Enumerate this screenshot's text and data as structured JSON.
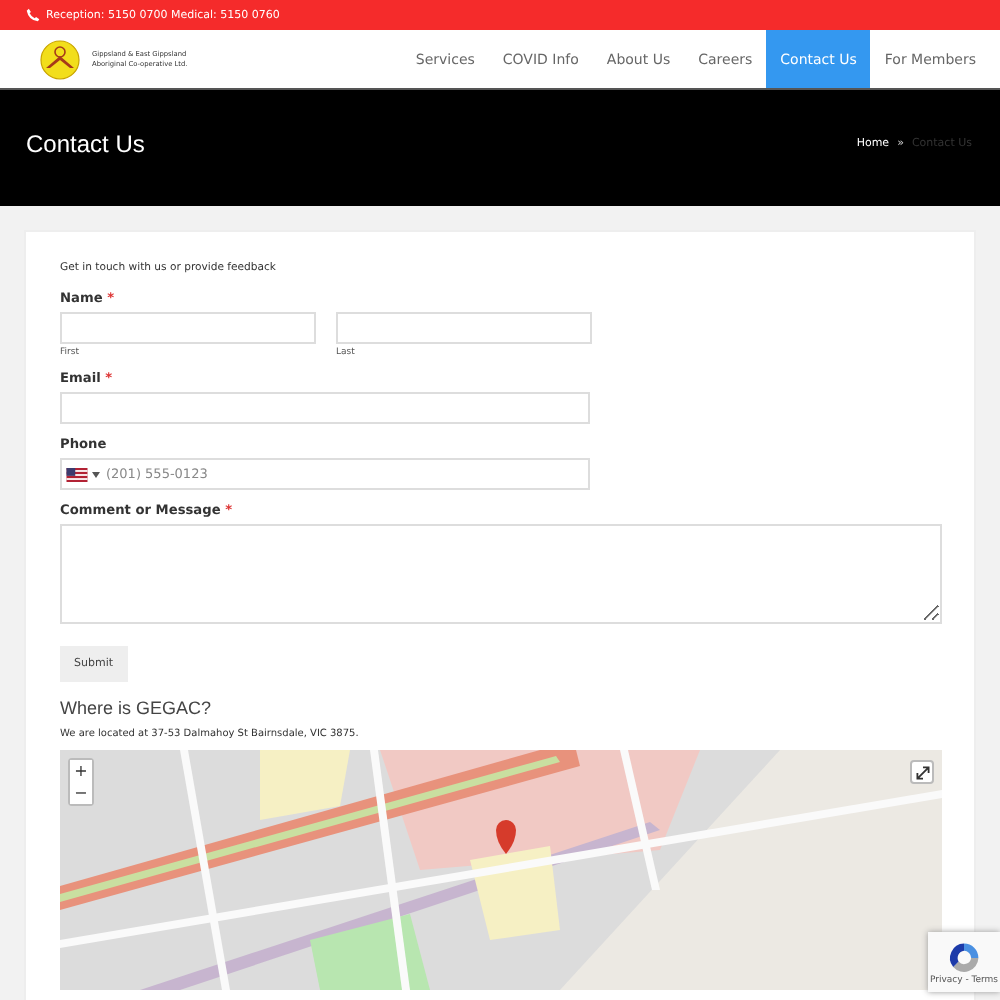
{
  "top_bar": {
    "phone_text": "Reception: 5150 0700 Medical: 5150 0760"
  },
  "header": {
    "logo_text": "Gippsland & East Gippsland Aboriginal Co-operative Ltd.",
    "nav": [
      {
        "label": "Services",
        "selected": false
      },
      {
        "label": "COVID Info",
        "selected": false
      },
      {
        "label": "About Us",
        "selected": false
      },
      {
        "label": "Careers",
        "selected": false
      },
      {
        "label": "Contact Us",
        "selected": true
      },
      {
        "label": "For Members",
        "selected": false
      }
    ]
  },
  "hero": {
    "title": "Contact Us",
    "breadcrumb": [
      {
        "label": "Home",
        "selected": false
      },
      {
        "label": "»",
        "kind": "separator"
      },
      {
        "label": "Contact Us",
        "selected": true
      }
    ]
  },
  "form": {
    "intro": "Get in touch with us or provide feedback",
    "fields": [
      {
        "kind": "name",
        "label": "Name",
        "required": true,
        "sublabels": [
          "First",
          "Last"
        ]
      },
      {
        "kind": "text",
        "label": "Email",
        "required": true
      },
      {
        "kind": "phone",
        "label": "Phone",
        "required": false,
        "placeholder": "(201) 555-0123"
      },
      {
        "kind": "textarea",
        "label": "Comment or Message",
        "required": true
      }
    ],
    "required_mark": "*",
    "submit": "Submit"
  },
  "location": {
    "title": "Where is GEGAC?",
    "text": "We are located at 37-53 Dalmahoy St Bairnsdale, VIC 3875.",
    "map": {
      "kind": "picture",
      "zoom_in": "+",
      "zoom_out": "−"
    }
  },
  "recaptcha": {
    "text": "Privacy - Terms"
  }
}
